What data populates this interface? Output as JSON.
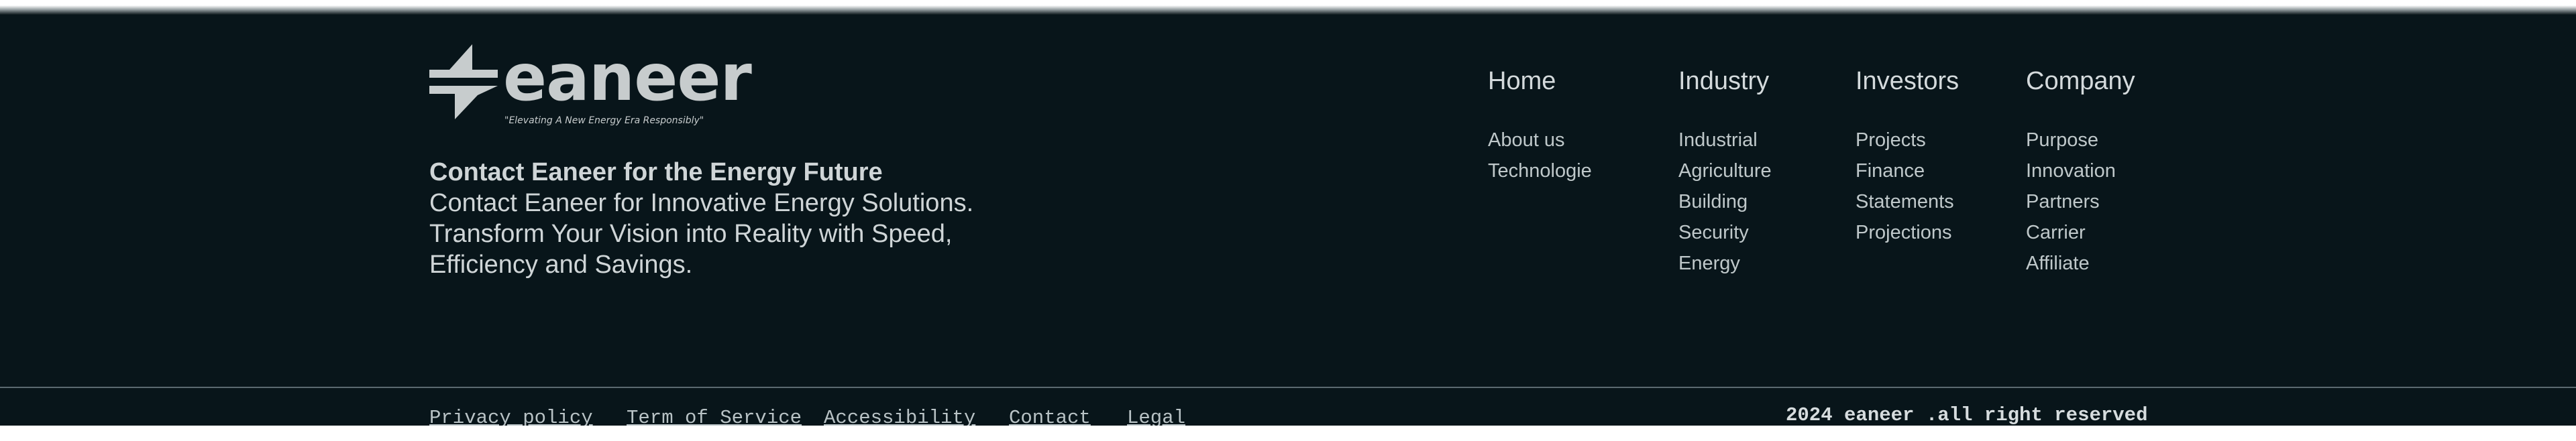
{
  "brand": {
    "name": "eaneer",
    "tagline": "\"Elevating A New Energy Era Responsibly\"",
    "logo_icon": "lightning-split-icon"
  },
  "contact": {
    "title": "Contact Eaneer for the Energy Future",
    "body": "Contact Eaneer for Innovative Energy Solutions. Transform Your Vision into Reality with Speed, Efficiency and Savings."
  },
  "nav": {
    "home": {
      "heading": "Home",
      "items": [
        "About us",
        "Technologie"
      ]
    },
    "industry": {
      "heading": "Industry",
      "items": [
        "Industrial",
        "Agriculture",
        "Building",
        "Security",
        "Energy"
      ]
    },
    "investors": {
      "heading": "Investors",
      "items": [
        "Projects",
        "Finance",
        "Statements",
        "Projections"
      ]
    },
    "company": {
      "heading": "Company",
      "items": [
        "Purpose",
        "Innovation",
        "Partners",
        "Carrier",
        "Affiliate"
      ]
    }
  },
  "legal": {
    "privacy": "Privacy policy",
    "terms": "Term of Service",
    "accessibility": "Accessibility",
    "contact": "Contact",
    "legal": "Legal"
  },
  "copyright": "2024 eaneer .all right reserved",
  "colors": {
    "background": "#08151a",
    "text": "#c9d1d3",
    "divider": "#5b6a70"
  }
}
